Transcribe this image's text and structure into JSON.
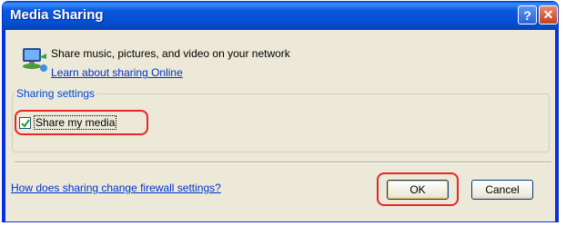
{
  "window": {
    "title": "Media Sharing",
    "help_label": "?",
    "close_label": "✕"
  },
  "header": {
    "heading": "Share music, pictures, and video on your network",
    "learn_link": "Learn about sharing Online"
  },
  "settings": {
    "group_label": "Sharing settings",
    "share_label": "Share my media",
    "share_checked": true
  },
  "footer": {
    "firewall_link": "How does sharing change firewall settings?",
    "ok_label": "OK",
    "cancel_label": "Cancel"
  },
  "colors": {
    "titlebar": "#0450d4",
    "window_face": "#ece9d8",
    "link": "#0033cc",
    "highlight": "#e8262a"
  },
  "icons": [
    "network-sharing-icon",
    "help-icon",
    "close-icon",
    "checkmark-icon"
  ]
}
